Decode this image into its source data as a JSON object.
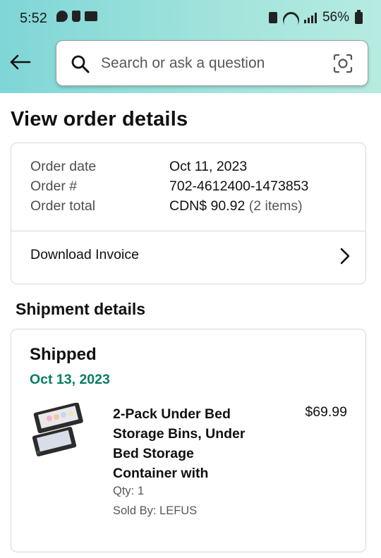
{
  "status_bar": {
    "time": "5:52",
    "battery": "56%"
  },
  "search": {
    "placeholder": "Search or ask a question"
  },
  "page_title": "View order details",
  "order": {
    "date_label": "Order date",
    "date_value": "Oct 11, 2023",
    "number_label": "Order #",
    "number_value": "702-4612400-1473853",
    "total_label": "Order total",
    "total_value": "CDN$ 90.92",
    "total_items": "(2 items)",
    "invoice_label": "Download Invoice"
  },
  "shipment": {
    "heading": "Shipment details",
    "status": "Shipped",
    "date": "Oct 13, 2023",
    "item": {
      "title": "2-Pack Under Bed Storage Bins, Under Bed Storage Container with",
      "price": "$69.99",
      "qty": "Qty: 1",
      "seller": "Sold By: LEFUS"
    }
  },
  "colors": {
    "header_gradient_start": "#7fd6d6",
    "header_gradient_end": "#b6ebe0",
    "delivered_green": "#067d62",
    "text_primary": "#0f1111",
    "text_secondary": "#565959",
    "border": "#d5d9d9"
  }
}
